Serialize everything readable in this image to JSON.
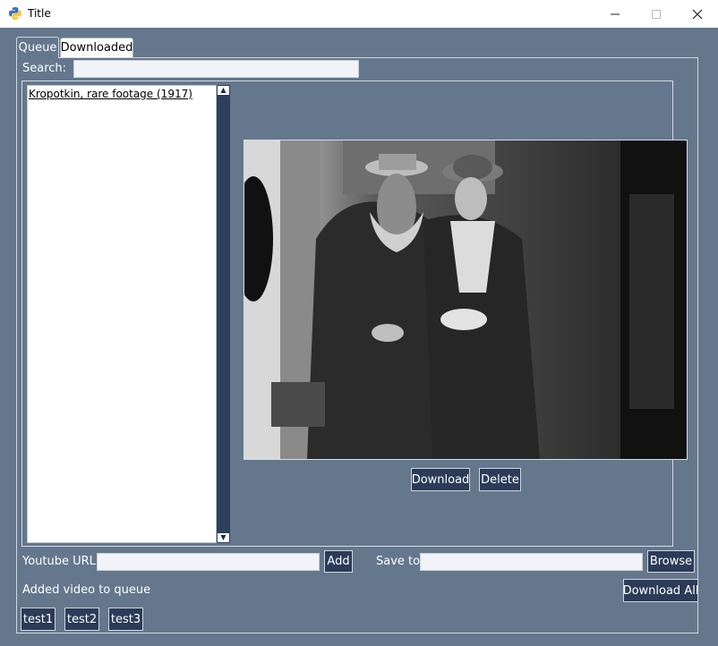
{
  "window": {
    "title": "Title",
    "minimize": "—",
    "maximize": "☐",
    "close": "✕"
  },
  "tabs": [
    {
      "label": "Queue",
      "active": true
    },
    {
      "label": "Downloaded",
      "active": false
    }
  ],
  "search": {
    "label": "Search:",
    "value": ""
  },
  "queue": {
    "items": [
      {
        "label": "Kropotkin, rare footage (1917)"
      }
    ]
  },
  "scroll": {
    "up": "▲",
    "down": "▼"
  },
  "video": {
    "description_icon": "video-thumbnail"
  },
  "actions": {
    "download": "Download",
    "delete": "Delete"
  },
  "url": {
    "label": "Youtube URL:",
    "value": "",
    "add": "Add"
  },
  "save": {
    "label": "Save to:",
    "value": "",
    "browse": "Browse"
  },
  "status": "Added video to queue",
  "download_all": "Download All",
  "tests": [
    "test1",
    "test2",
    "test3"
  ],
  "colors": {
    "background": "#64778d",
    "button": "#2b3b58",
    "scrollbar": "#2d3f5c",
    "input": "#f1f3f8"
  }
}
